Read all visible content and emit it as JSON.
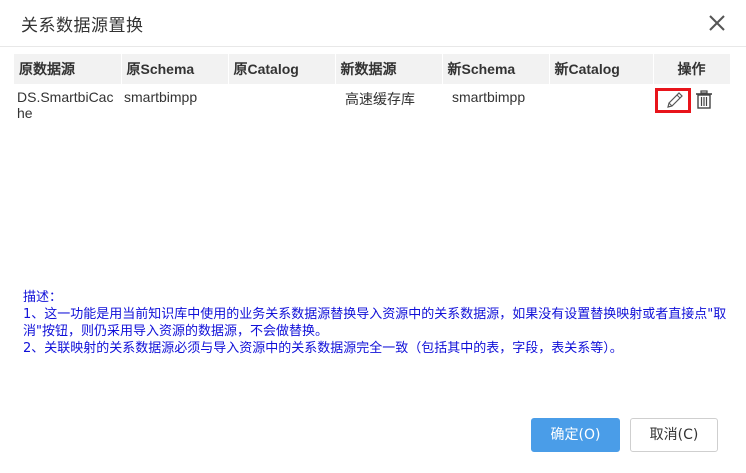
{
  "dialog": {
    "title": "关系数据源置换"
  },
  "table": {
    "headers": [
      "原数据源",
      "原Schema",
      "原Catalog",
      "新数据源",
      "新Schema",
      "新Catalog",
      "操作"
    ],
    "rows": [
      {
        "orig_source": "DS.SmartbiCache",
        "orig_schema": "smartbimpp",
        "orig_catalog": "",
        "new_source": "高速缓存库",
        "new_schema": "smartbimpp",
        "new_catalog": ""
      }
    ]
  },
  "description": {
    "heading": "描述：",
    "line1": "1、这一功能是用当前知识库中使用的业务关系数据源替换导入资源中的关系数据源，如果没有设置替换映射或者直接点\"取消\"按钮，则仍采用导入资源的数据源，不会做替换。",
    "line2": "2、关联映射的关系数据源必须与导入资源中的关系数据源完全一致（包括其中的表，字段，表关系等）。"
  },
  "buttons": {
    "ok": "确定(O)",
    "cancel": "取消(C)"
  },
  "colors": {
    "primary": "#4a9de8",
    "description_text": "#1010d8",
    "highlight": "#e8141b"
  },
  "icons": {
    "close": "close-icon",
    "edit": "pencil-icon",
    "delete": "trash-icon"
  }
}
